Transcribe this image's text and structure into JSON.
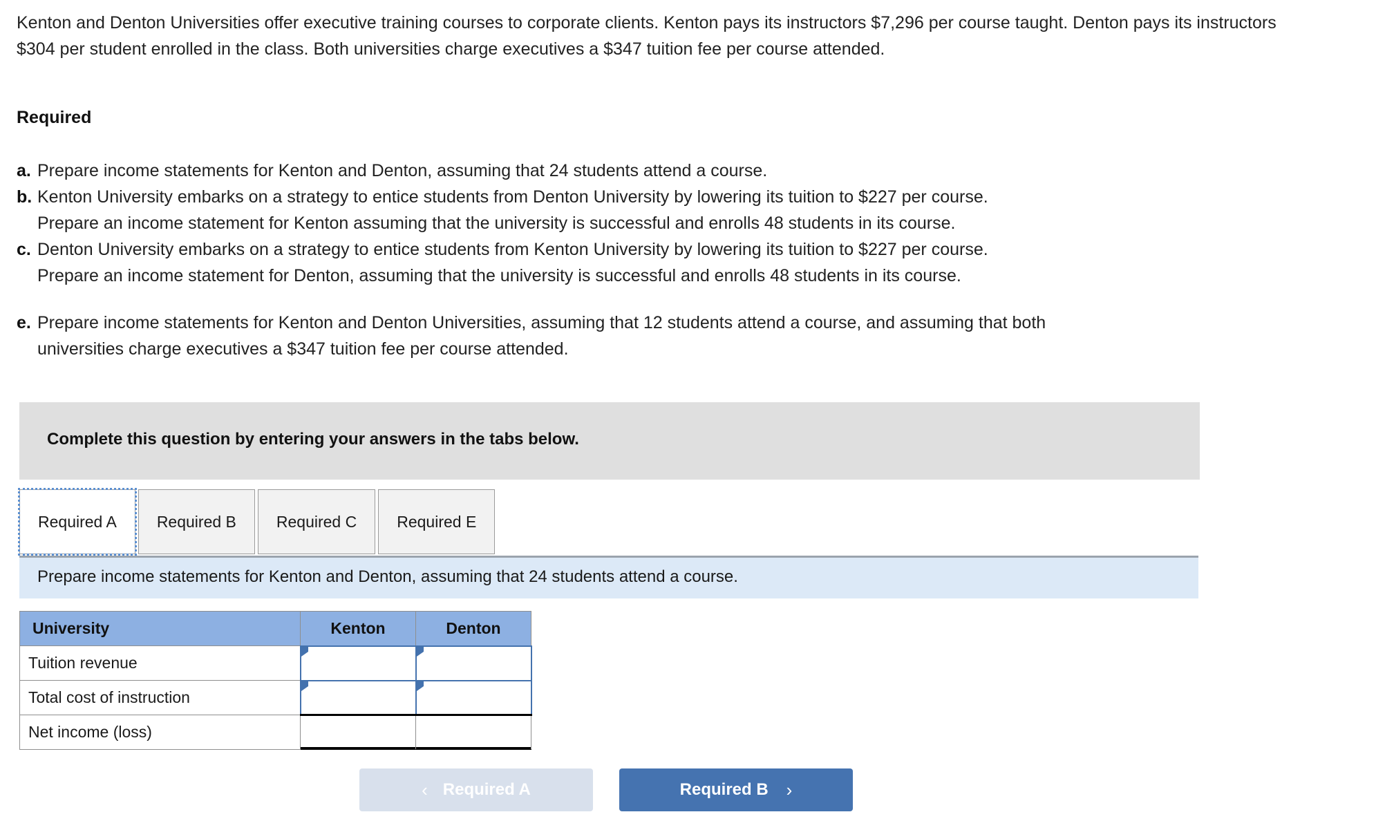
{
  "problem": {
    "intro": "Kenton and Denton Universities offer executive training courses to corporate clients. Kenton pays its instructors $7,296 per course taught. Denton pays its instructors $304 per student enrolled in the class. Both universities charge executives a $347 tuition fee per course attended.",
    "required_heading": "Required",
    "requirements": [
      {
        "marker": "a.",
        "lines": [
          "Prepare income statements for Kenton and Denton, assuming that 24 students attend a course."
        ]
      },
      {
        "marker": "b.",
        "lines": [
          "Kenton University embarks on a strategy to entice students from Denton University by lowering its tuition to $227 per course.",
          "Prepare an income statement for Kenton assuming that the university is successful and enrolls 48 students in its course."
        ]
      },
      {
        "marker": "c.",
        "lines": [
          "Denton University embarks on a strategy to entice students from Kenton University by lowering its tuition to $227 per course.",
          "Prepare an income statement for Denton, assuming that the university is successful and enrolls 48 students in its course."
        ]
      },
      {
        "marker": "e.",
        "lines": [
          "Prepare income statements for Kenton and Denton Universities, assuming that 12 students attend a course, and assuming that both",
          "universities charge executives a $347 tuition fee per course attended."
        ]
      }
    ]
  },
  "banner": {
    "text": "Complete this question by entering your answers in the tabs below."
  },
  "tabs": [
    {
      "label": "Required A",
      "active": true
    },
    {
      "label": "Required B",
      "active": false
    },
    {
      "label": "Required C",
      "active": false
    },
    {
      "label": "Required E",
      "active": false
    }
  ],
  "instruction_bar": {
    "text": "Prepare income statements for Kenton and Denton, assuming that 24 students attend a course."
  },
  "answer_table": {
    "headers": [
      "University",
      "Kenton",
      "Denton"
    ],
    "rows": [
      {
        "label": "Tuition revenue",
        "kenton": "",
        "denton": "",
        "input": true,
        "total": false
      },
      {
        "label": "Total cost of instruction",
        "kenton": "",
        "denton": "",
        "input": true,
        "total": false
      },
      {
        "label": "Net income (loss)",
        "kenton": "",
        "denton": "",
        "input": false,
        "total": true
      }
    ]
  },
  "nav": {
    "prev_label": "Required A",
    "next_label": "Required B",
    "prev_chevron": "‹",
    "next_chevron": "›"
  },
  "colors": {
    "banner_grey": "#dfdfdf",
    "instruction_blue": "#dce9f7",
    "table_header_blue": "#8db0e2",
    "input_border_blue": "#4472ae",
    "next_button_blue": "#4573b0",
    "prev_button_blue": "#d8e0ec",
    "focus_outline_blue": "#5b8fd0"
  }
}
